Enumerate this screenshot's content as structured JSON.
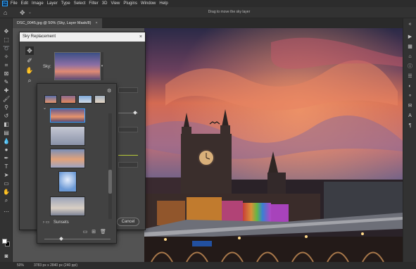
{
  "app": {
    "logo": "Ps"
  },
  "menu": [
    "File",
    "Edit",
    "Image",
    "Layer",
    "Type",
    "Select",
    "Filter",
    "3D",
    "View",
    "Plugins",
    "Window",
    "Help"
  ],
  "options_bar": {
    "hint": "Drag to move the sky layer"
  },
  "document_tab": {
    "title": "DSC_0045.jpg @ 50% (Sky, Layer Mask/8)",
    "close": "×"
  },
  "dialog": {
    "title": "Sky Replacement",
    "close": "×",
    "sky_label": "Sky:",
    "cancel_label": "Cancel"
  },
  "picker": {
    "folder_label": "Sunsets",
    "icons": {
      "settings": "gear-icon",
      "folder": "folder-icon",
      "new_group": "new-folder-icon",
      "add": "add-icon",
      "delete": "trash-icon"
    }
  },
  "status_bar": {
    "zoom": "50%",
    "size": "3783 px x 2840 px (240 ppi)"
  },
  "colors": {
    "accent": "#31a8ff",
    "chrome": "#323232",
    "canvas_bg": "#535353"
  }
}
